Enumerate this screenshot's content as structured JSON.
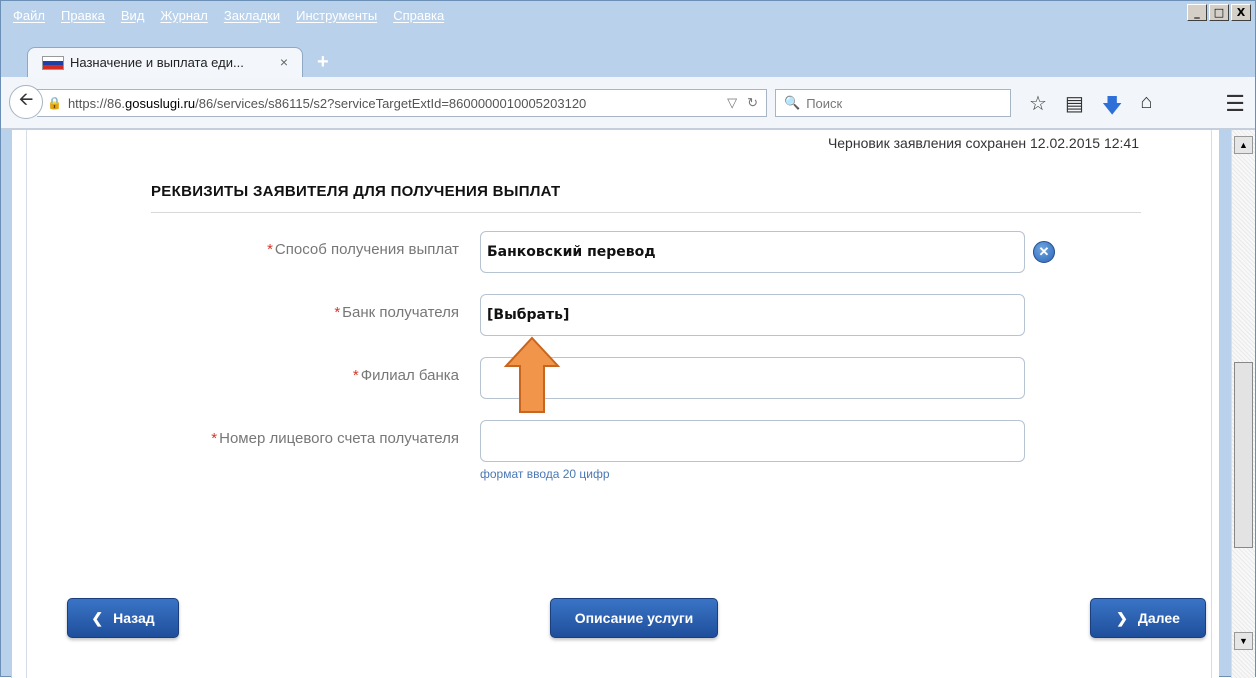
{
  "menu": [
    "Файл",
    "Правка",
    "Вид",
    "Журнал",
    "Закладки",
    "Инструменты",
    "Справка"
  ],
  "window_controls": [
    "_",
    "□",
    "X"
  ],
  "tab": {
    "title": "Назначение и выплата еди...",
    "close": "×",
    "new_tab": "+"
  },
  "address_bar": {
    "url_prefix": "https://86.",
    "url_host": "gosuslugi.ru",
    "url_path": "/86/services/s86115/s2?serviceTargetExtId=8600000010005203120"
  },
  "search": {
    "placeholder": "Поиск"
  },
  "page": {
    "draft_status": "Черновик заявления сохранен 12.02.2015 12:41",
    "section_title": "РЕКВИЗИТЫ ЗАЯВИТЕЛЯ ДЛЯ ПОЛУЧЕНИЯ ВЫПЛАТ",
    "fields": [
      {
        "label": "Способ получения выплат",
        "value": "Банковский перевод"
      },
      {
        "label": "Банк получателя",
        "value": "[Выбрать]"
      },
      {
        "label": "Филиал банка",
        "value": ""
      },
      {
        "label": "Номер лицевого счета получателя",
        "value": ""
      }
    ],
    "account_hint": "формат ввода 20 цифр",
    "required_mark": "*"
  },
  "buttons": {
    "back": "Назад",
    "description": "Описание услуги",
    "next": "Далее"
  },
  "colors": {
    "accent_button": "#2a5fae",
    "required": "#d9342b",
    "annotation_arrow": "#f0954a"
  }
}
